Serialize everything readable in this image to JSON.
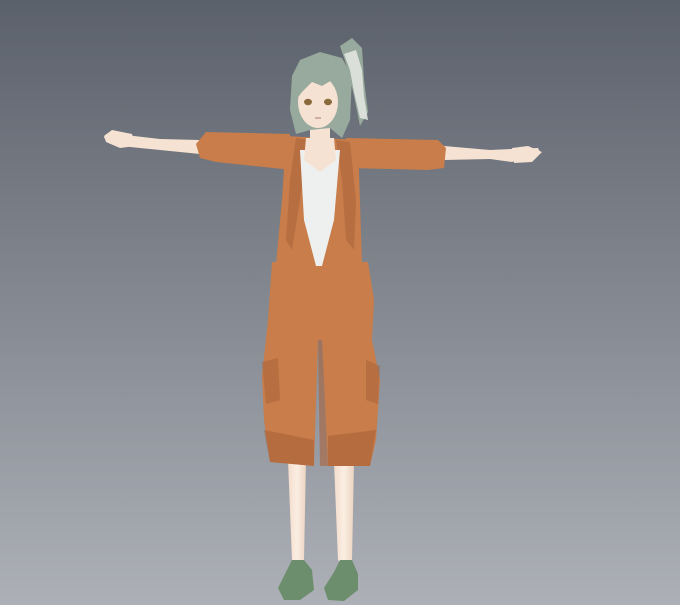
{
  "viewport": {
    "background_top": "#5b616b",
    "background_bottom": "#adb0b7"
  },
  "character": {
    "pose": "T-pose",
    "skin_color": "#f6e2d2",
    "hair_color": "#98aa9d",
    "hair_ribbon_color": "#e6e9e4",
    "jumpsuit_color": "#c87d4a",
    "jumpsuit_shadow": "#a9633a",
    "top_color": "#eef0ef",
    "eye_color": "#8a6a3c",
    "shoe_color": "#6c8e6d"
  }
}
